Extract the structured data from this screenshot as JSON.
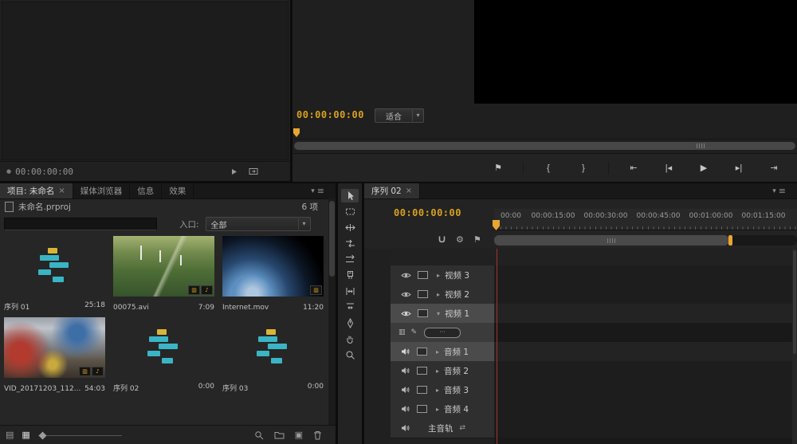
{
  "glyphs": {
    "close": "×",
    "menu": "≡",
    "caret": "▾",
    "arrow": "▸",
    "dot": "●",
    "list_view": "▤",
    "icon_view": "▦",
    "new_item": "▣",
    "note": "♪",
    "film_badge": "▥",
    "display_style": "▥",
    "pencil": "✎",
    "gear": "⚙",
    "flag": "⚑",
    "swap": "⇄",
    "dots": "···"
  },
  "source_monitor": {
    "timecode": "00:00:00:00"
  },
  "program_monitor": {
    "timecode": "00:00:00:00",
    "zoom_mode": "适合",
    "transport": [
      {
        "name": "add-marker",
        "glyph": "⚑"
      },
      {
        "name": "mark-in",
        "glyph": "{"
      },
      {
        "name": "mark-out",
        "glyph": "}"
      },
      {
        "name": "go-to-in",
        "glyph": "⇤"
      },
      {
        "name": "step-back",
        "glyph": "|◂"
      },
      {
        "name": "play",
        "glyph": "▶"
      },
      {
        "name": "step-forward",
        "glyph": "▸|"
      },
      {
        "name": "go-to-out",
        "glyph": "⇥"
      }
    ]
  },
  "project": {
    "tabs": [
      "项目: 未命名",
      "媒体浏览器",
      "信息",
      "效果"
    ],
    "file_name": "未命名.prproj",
    "item_count": "6 项",
    "search_value": "",
    "filter_label": "入口:",
    "filter_value": "全部",
    "items": [
      {
        "name": "序列 01",
        "duration": "25:18"
      },
      {
        "name": "00075.avi",
        "duration": "7:09"
      },
      {
        "name": "Internet.mov",
        "duration": "11:20"
      },
      {
        "name": "VID_20171203_112...",
        "duration": "54:03"
      },
      {
        "name": "序列 02",
        "duration": "0:00"
      },
      {
        "name": "序列 03",
        "duration": "0:00"
      }
    ]
  },
  "tools": [
    {
      "label": "选择工具"
    },
    {
      "label": "轨道选择工具"
    },
    {
      "label": "波纹编辑工具"
    },
    {
      "label": "滚动编辑工具"
    },
    {
      "label": "速率伸缩工具"
    },
    {
      "label": "剃刀工具"
    },
    {
      "label": "外滑工具"
    },
    {
      "label": "内滑工具"
    },
    {
      "label": "钢笔工具"
    },
    {
      "label": "手形工具"
    },
    {
      "label": "缩放工具"
    }
  ],
  "timeline": {
    "tab": "序列 02",
    "timecode": "00:00:00:00",
    "ruler": [
      "00:00",
      "00:00:15:00",
      "00:00:30:00",
      "00:00:45:00",
      "00:01:00:00",
      "00:01:15:00"
    ],
    "tracks": [
      {
        "name": "视频 3"
      },
      {
        "name": "视频 2"
      },
      {
        "name": "视频 1"
      },
      {
        "name": "音频 1"
      },
      {
        "name": "音频 2"
      },
      {
        "name": "音频 3"
      },
      {
        "name": "音频 4"
      },
      {
        "name": "主音轨"
      }
    ]
  }
}
